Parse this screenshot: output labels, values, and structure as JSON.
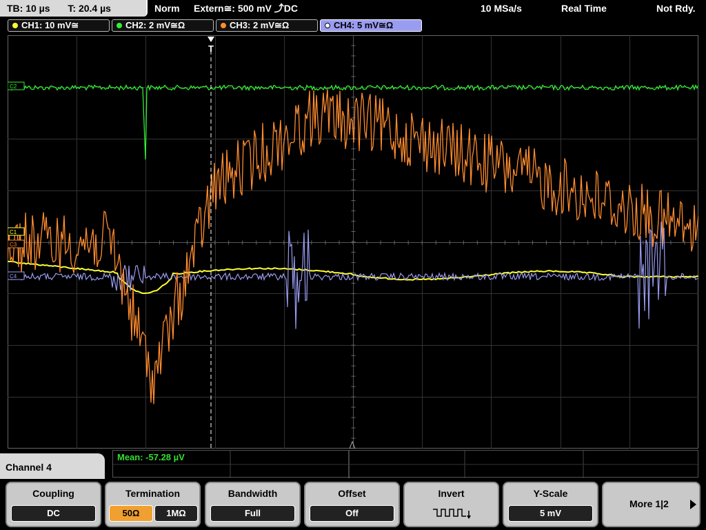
{
  "topbar": {
    "timebase": "TB: 10 µs",
    "trigger_time": "T: 20.4 µs",
    "trigger_mode": "Norm",
    "trigger_source": "Extern≅: 500 mV ⤴DC",
    "sample_rate": "10 MSa/s",
    "acq_mode": "Real Time",
    "status": "Not Rdy."
  },
  "channels": [
    {
      "label": "CH1: 10 mV≅",
      "color": "#ffff33"
    },
    {
      "label": "CH2: 2 mV≅Ω",
      "color": "#33ee33"
    },
    {
      "label": "CH3: 2 mV≅Ω",
      "color": "#ff8c2e"
    },
    {
      "label": "CH4: 5 mV≅Ω",
      "color": "#9a9cf0"
    }
  ],
  "markers": {
    "trigger": "T",
    "ch2": "C2",
    "ch1": "C1",
    "ch3": "C3",
    "ch4": "C4"
  },
  "measurement": {
    "label": "Mean: -57.28 µV"
  },
  "channel_menu": {
    "title": "Channel 4"
  },
  "softkeys": {
    "coupling": {
      "title": "Coupling",
      "value": "DC"
    },
    "termination": {
      "title": "Termination",
      "opt1": "50Ω",
      "opt2": "1MΩ"
    },
    "bandwidth": {
      "title": "Bandwidth",
      "value": "Full"
    },
    "offset": {
      "title": "Offset",
      "value": "Off"
    },
    "invert": {
      "title": "Invert",
      "icon": "invert-waveform-icon"
    },
    "yscale": {
      "title": "Y-Scale",
      "value": "5 mV"
    },
    "more": {
      "label": "More 1|2"
    }
  }
}
